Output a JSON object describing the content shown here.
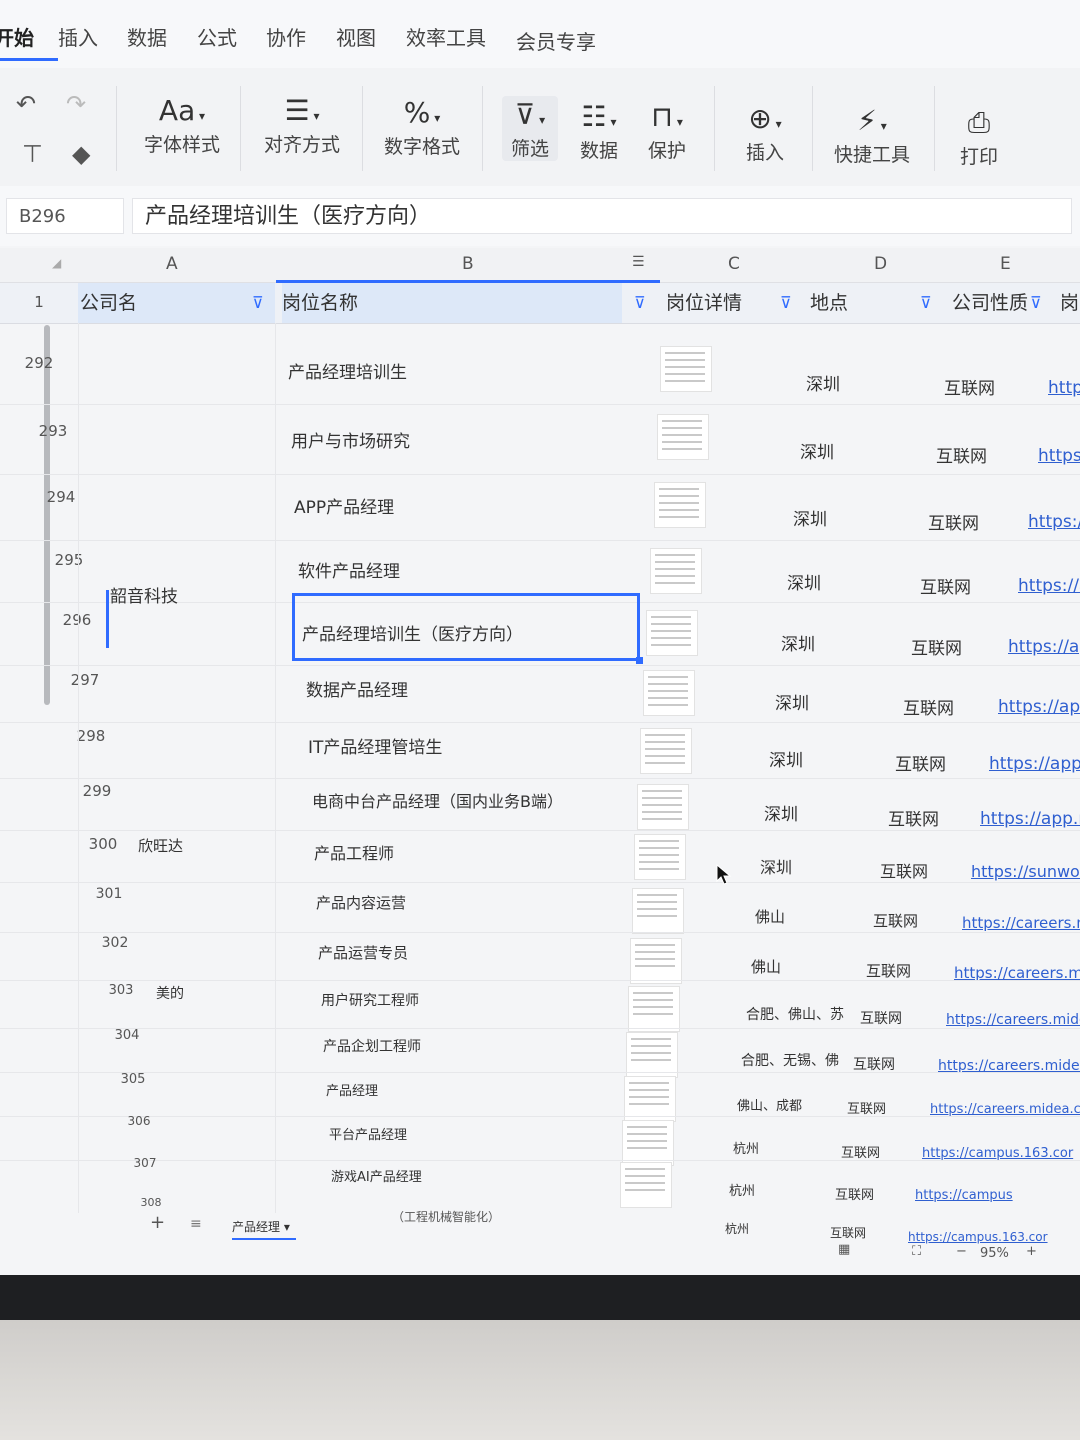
{
  "menu": {
    "items": [
      "开始",
      "插入",
      "数据",
      "公式",
      "协作",
      "视图",
      "效率工具",
      "会员专享"
    ]
  },
  "ribbon": {
    "font_style": "字体样式",
    "align": "对齐方式",
    "number_format": "数字格式",
    "filter": "筛选",
    "data": "数据",
    "protect": "保护",
    "insert": "插入",
    "quick_tools": "快捷工具",
    "print": "打印",
    "font_icon_text": "Aa",
    "percent_icon_text": "%"
  },
  "formula_bar": {
    "cell_ref": "B296",
    "content": "产品经理培训生（医疗方向）"
  },
  "columns": [
    "A",
    "B",
    "C",
    "D",
    "E"
  ],
  "headers": {
    "row_num": "1",
    "company": "公司名",
    "position": "岗位名称",
    "detail": "岗位详情",
    "location": "地点",
    "company_type": "公司性质",
    "extra": "岗"
  },
  "rows": [
    {
      "num": "292",
      "company": "",
      "position": "产品经理培训生",
      "location": "深圳",
      "type": "互联网",
      "link": "http"
    },
    {
      "num": "293",
      "company": "",
      "position": "用户与市场研究",
      "location": "深圳",
      "type": "互联网",
      "link": "https"
    },
    {
      "num": "294",
      "company": "",
      "position": "APP产品经理",
      "location": "深圳",
      "type": "互联网",
      "link": "https:/"
    },
    {
      "num": "295",
      "company": "",
      "position": "软件产品经理",
      "location": "深圳",
      "type": "互联网",
      "link": "https://a"
    },
    {
      "num": "296",
      "company": "韶音科技",
      "position": "产品经理培训生（医疗方向）",
      "location": "深圳",
      "type": "互联网",
      "link": "https://ap"
    },
    {
      "num": "297",
      "company": "",
      "position": "数据产品经理",
      "location": "深圳",
      "type": "互联网",
      "link": "https://app"
    },
    {
      "num": "298",
      "company": "",
      "position": "IT产品经理管培生",
      "location": "深圳",
      "type": "互联网",
      "link": "https://app.i"
    },
    {
      "num": "299",
      "company": "",
      "position": "电商中台产品经理（国内业务B端）",
      "location": "深圳",
      "type": "互联网",
      "link": "https://app.m"
    },
    {
      "num": "300",
      "company": "欣旺达",
      "position": "产品工程师",
      "location": "深圳",
      "type": "互联网",
      "link": "https://sunwod"
    },
    {
      "num": "301",
      "company": "",
      "position": "产品内容运营",
      "location": "佛山",
      "type": "互联网",
      "link": "https://careers.m"
    },
    {
      "num": "302",
      "company": "",
      "position": "产品运营专员",
      "location": "佛山",
      "type": "互联网",
      "link": "https://careers.mi"
    },
    {
      "num": "303",
      "company": "美的",
      "position": "用户研究工程师",
      "location": "合肥、佛山、苏",
      "type": "互联网",
      "link": "https://careers.mide"
    },
    {
      "num": "304",
      "company": "",
      "position": "产品企划工程师",
      "location": "合肥、无锡、佛",
      "type": "互联网",
      "link": "https://careers.midea"
    },
    {
      "num": "305",
      "company": "",
      "position": "产品经理",
      "location": "佛山、成都",
      "type": "互联网",
      "link": "https://careers.midea.c"
    },
    {
      "num": "306",
      "company": "",
      "position": "平台产品经理",
      "location": "杭州",
      "type": "互联网",
      "link": "https://campus.163.cor"
    },
    {
      "num": "307",
      "company": "",
      "position": "游戏AI产品经理",
      "location": "杭州",
      "type": "互联网",
      "link": "https://campus"
    },
    {
      "num": "308",
      "company": "",
      "position": "（工程机械智能化）",
      "location": "杭州",
      "type": "互联网",
      "link": "https://campus.163.cor"
    }
  ],
  "sheet": {
    "tab_name": "产品经理",
    "add_label": "+",
    "zoom": "95%",
    "zoom_minus": "−",
    "zoom_plus": "+"
  }
}
